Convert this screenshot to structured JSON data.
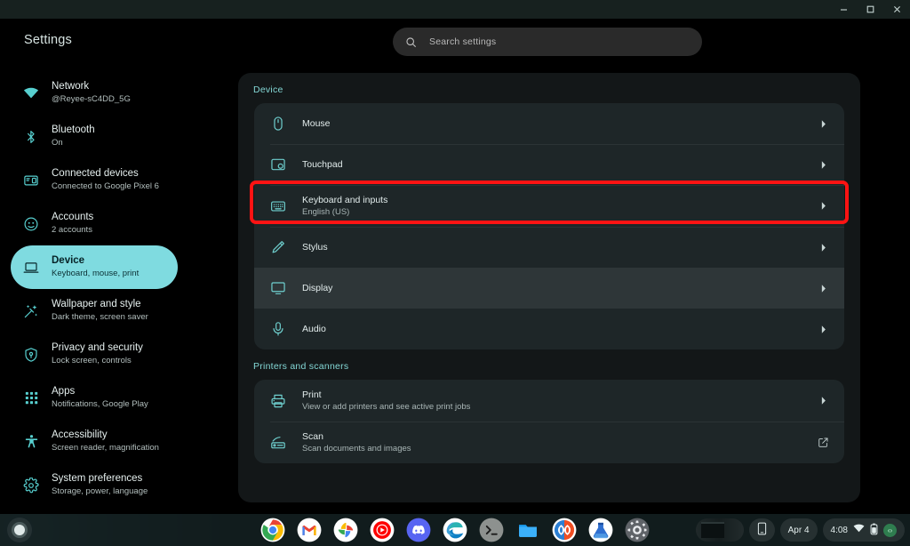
{
  "window": {
    "minimize_label": "Minimize",
    "maximize_label": "Maximize",
    "close_label": "Close"
  },
  "app": {
    "title": "Settings"
  },
  "search": {
    "placeholder": "Search settings",
    "value": "",
    "icon": "search-icon"
  },
  "sidebar": {
    "items": [
      {
        "label": "Network",
        "sub": "@Reyee-sC4DD_5G",
        "icon": "wifi-icon",
        "selected": false
      },
      {
        "label": "Bluetooth",
        "sub": "On",
        "icon": "bluetooth-icon",
        "selected": false
      },
      {
        "label": "Connected devices",
        "sub": "Connected to Google Pixel 6",
        "icon": "connected-devices-icon",
        "selected": false
      },
      {
        "label": "Accounts",
        "sub": "2 accounts",
        "icon": "account-icon",
        "selected": false
      },
      {
        "label": "Device",
        "sub": "Keyboard, mouse, print",
        "icon": "laptop-icon",
        "selected": true
      },
      {
        "label": "Wallpaper and style",
        "sub": "Dark theme, screen saver",
        "icon": "wallpaper-icon",
        "selected": false
      },
      {
        "label": "Privacy and security",
        "sub": "Lock screen, controls",
        "icon": "shield-icon",
        "selected": false
      },
      {
        "label": "Apps",
        "sub": "Notifications, Google Play",
        "icon": "apps-grid-icon",
        "selected": false
      },
      {
        "label": "Accessibility",
        "sub": "Screen reader, magnification",
        "icon": "accessibility-icon",
        "selected": false
      },
      {
        "label": "System preferences",
        "sub": "Storage, power, language",
        "icon": "settings-gear-icon",
        "selected": false
      }
    ]
  },
  "main": {
    "sections": [
      {
        "header": "Device",
        "rows": [
          {
            "title": "Mouse",
            "sub": "",
            "icon": "mouse-icon",
            "end": "chevron-right-icon",
            "hovered": false,
            "highlighted": false
          },
          {
            "title": "Touchpad",
            "sub": "",
            "icon": "touchpad-icon",
            "end": "chevron-right-icon",
            "hovered": false,
            "highlighted": false
          },
          {
            "title": "Keyboard and inputs",
            "sub": "English (US)",
            "icon": "keyboard-icon",
            "end": "chevron-right-icon",
            "hovered": false,
            "highlighted": true
          },
          {
            "title": "Stylus",
            "sub": "",
            "icon": "stylus-icon",
            "end": "chevron-right-icon",
            "hovered": false,
            "highlighted": false
          },
          {
            "title": "Display",
            "sub": "",
            "icon": "display-icon",
            "end": "chevron-right-icon",
            "hovered": true,
            "highlighted": false
          },
          {
            "title": "Audio",
            "sub": "",
            "icon": "microphone-icon",
            "end": "chevron-right-icon",
            "hovered": false,
            "highlighted": false
          }
        ]
      },
      {
        "header": "Printers and scanners",
        "rows": [
          {
            "title": "Print",
            "sub": "View or add printers and see active print jobs",
            "icon": "printer-icon",
            "end": "chevron-right-icon",
            "hovered": false,
            "highlighted": false
          },
          {
            "title": "Scan",
            "sub": "Scan documents and images",
            "icon": "scanner-icon",
            "end": "external-link-icon",
            "hovered": false,
            "highlighted": false
          }
        ]
      }
    ]
  },
  "shelf": {
    "launcher_label": "Launcher",
    "apps": [
      {
        "name": "chrome",
        "label": "Chrome",
        "running": false
      },
      {
        "name": "gmail",
        "label": "Gmail",
        "running": false
      },
      {
        "name": "photos",
        "label": "Photos",
        "running": false
      },
      {
        "name": "youtube-music",
        "label": "YouTube Music",
        "running": true
      },
      {
        "name": "discord",
        "label": "Discord",
        "running": false
      },
      {
        "name": "edge",
        "label": "Edge",
        "running": false
      },
      {
        "name": "terminal",
        "label": "Terminal",
        "running": false
      },
      {
        "name": "files",
        "label": "Files",
        "running": false
      },
      {
        "name": "media-app",
        "label": "Media",
        "running": true
      },
      {
        "name": "beaker",
        "label": "Beaker",
        "running": false
      },
      {
        "name": "settings",
        "label": "Settings",
        "running": true
      }
    ],
    "tray": {
      "date": "Apr 4",
      "time": "4:08",
      "wifi_icon": "wifi-icon",
      "battery_icon": "battery-icon",
      "vpn_badge": "‹›",
      "phone_icon": "phone-hub-icon"
    }
  },
  "colors": {
    "accent_teal": "#7fdbe0",
    "icon_teal": "#6fd0cf",
    "section_header": "#84d8d6",
    "annotation_red": "#ff1313",
    "card_bg": "#1e2628",
    "row_hover": "#2e3638",
    "panel_bg": "#131718"
  }
}
